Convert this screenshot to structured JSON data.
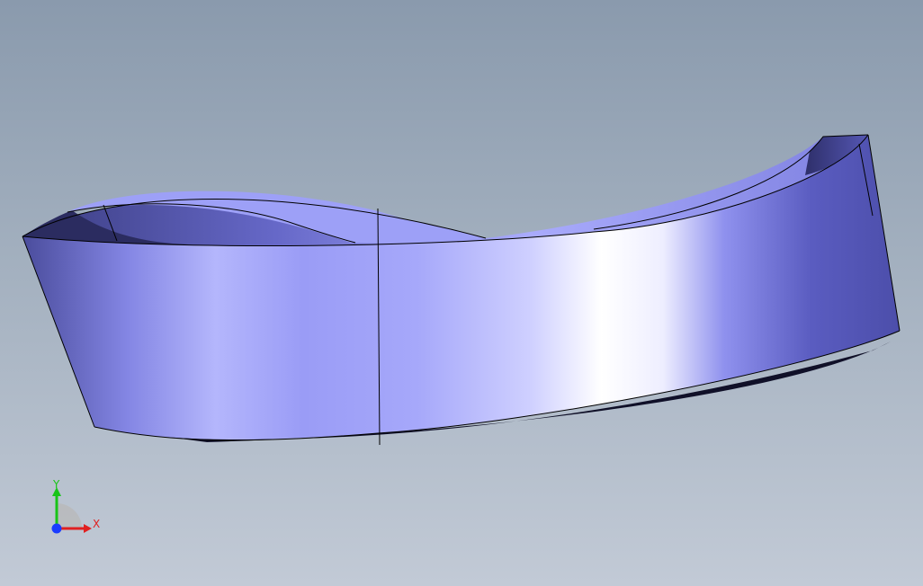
{
  "viewport": {
    "background_top": "#8a9aad",
    "background_bottom": "#c2cad6"
  },
  "model": {
    "kind": "twisted-band-surface",
    "face_color": "#8c8ef0",
    "edge_color": "#000000"
  },
  "triad": {
    "x_label": "X",
    "y_label": "Y",
    "x_color": "#e02020",
    "y_color": "#18c418",
    "z_color": "#1a3cff"
  }
}
